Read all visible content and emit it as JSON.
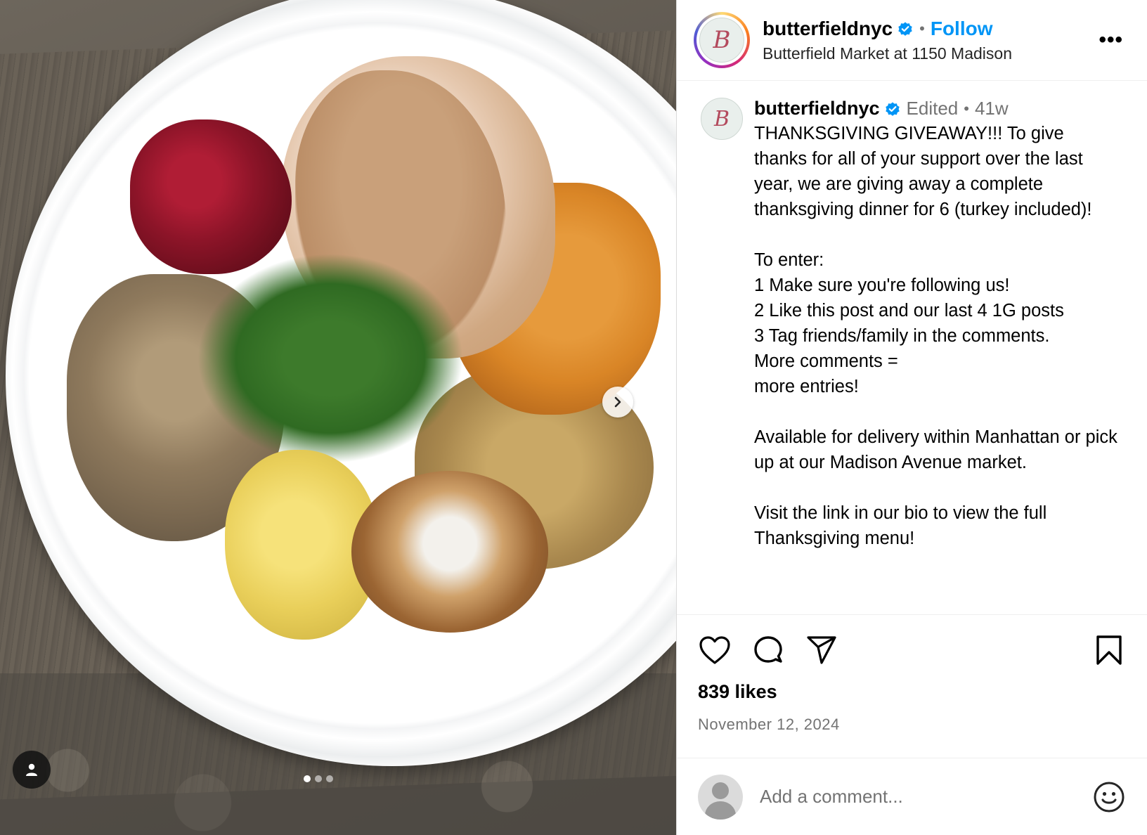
{
  "post": {
    "author": {
      "username": "butterfieldnyc",
      "verified": true,
      "avatar_logo_text": "B",
      "location": "Butterfield Market at 1150 Madison"
    },
    "header": {
      "separator": "•",
      "follow_label": "Follow",
      "more_icon": "ellipsis-icon",
      "more_label": "•••"
    },
    "caption": {
      "username": "butterfieldnyc",
      "edited_label": "Edited",
      "separator": "•",
      "age": "41w",
      "text": "THANKSGIVING GIVEAWAY!!! To give thanks for all of your support over the last year, we are giving away a complete thanksgiving dinner for 6 (turkey included)!\n\nTo enter:\n1 Make sure you're following us!\n2 Like this post and our last 4 1G posts\n3 Tag friends/family in the comments.\nMore comments =\nmore entries!\n\nAvailable for delivery within Manhattan or pick up at our Madison Avenue market.\n\nVisit the link in our bio to view the full Thanksgiving menu!"
    },
    "actions": {
      "like_icon": "heart-icon",
      "comment_icon": "comment-icon",
      "share_icon": "share-icon",
      "save_icon": "bookmark-icon"
    },
    "likes": "839 likes",
    "date": "November 12, 2024",
    "comment": {
      "placeholder": "Add a comment...",
      "emoji_icon": "smiley-icon"
    },
    "media": {
      "carousel_total": 3,
      "carousel_active_index": 0,
      "next_icon": "chevron-right-icon",
      "tag_icon": "user-tag-icon"
    }
  },
  "colors": {
    "follow_blue": "#0095f6",
    "verified_blue": "#0095f6",
    "muted_text": "#737373",
    "divider": "#efefef"
  }
}
